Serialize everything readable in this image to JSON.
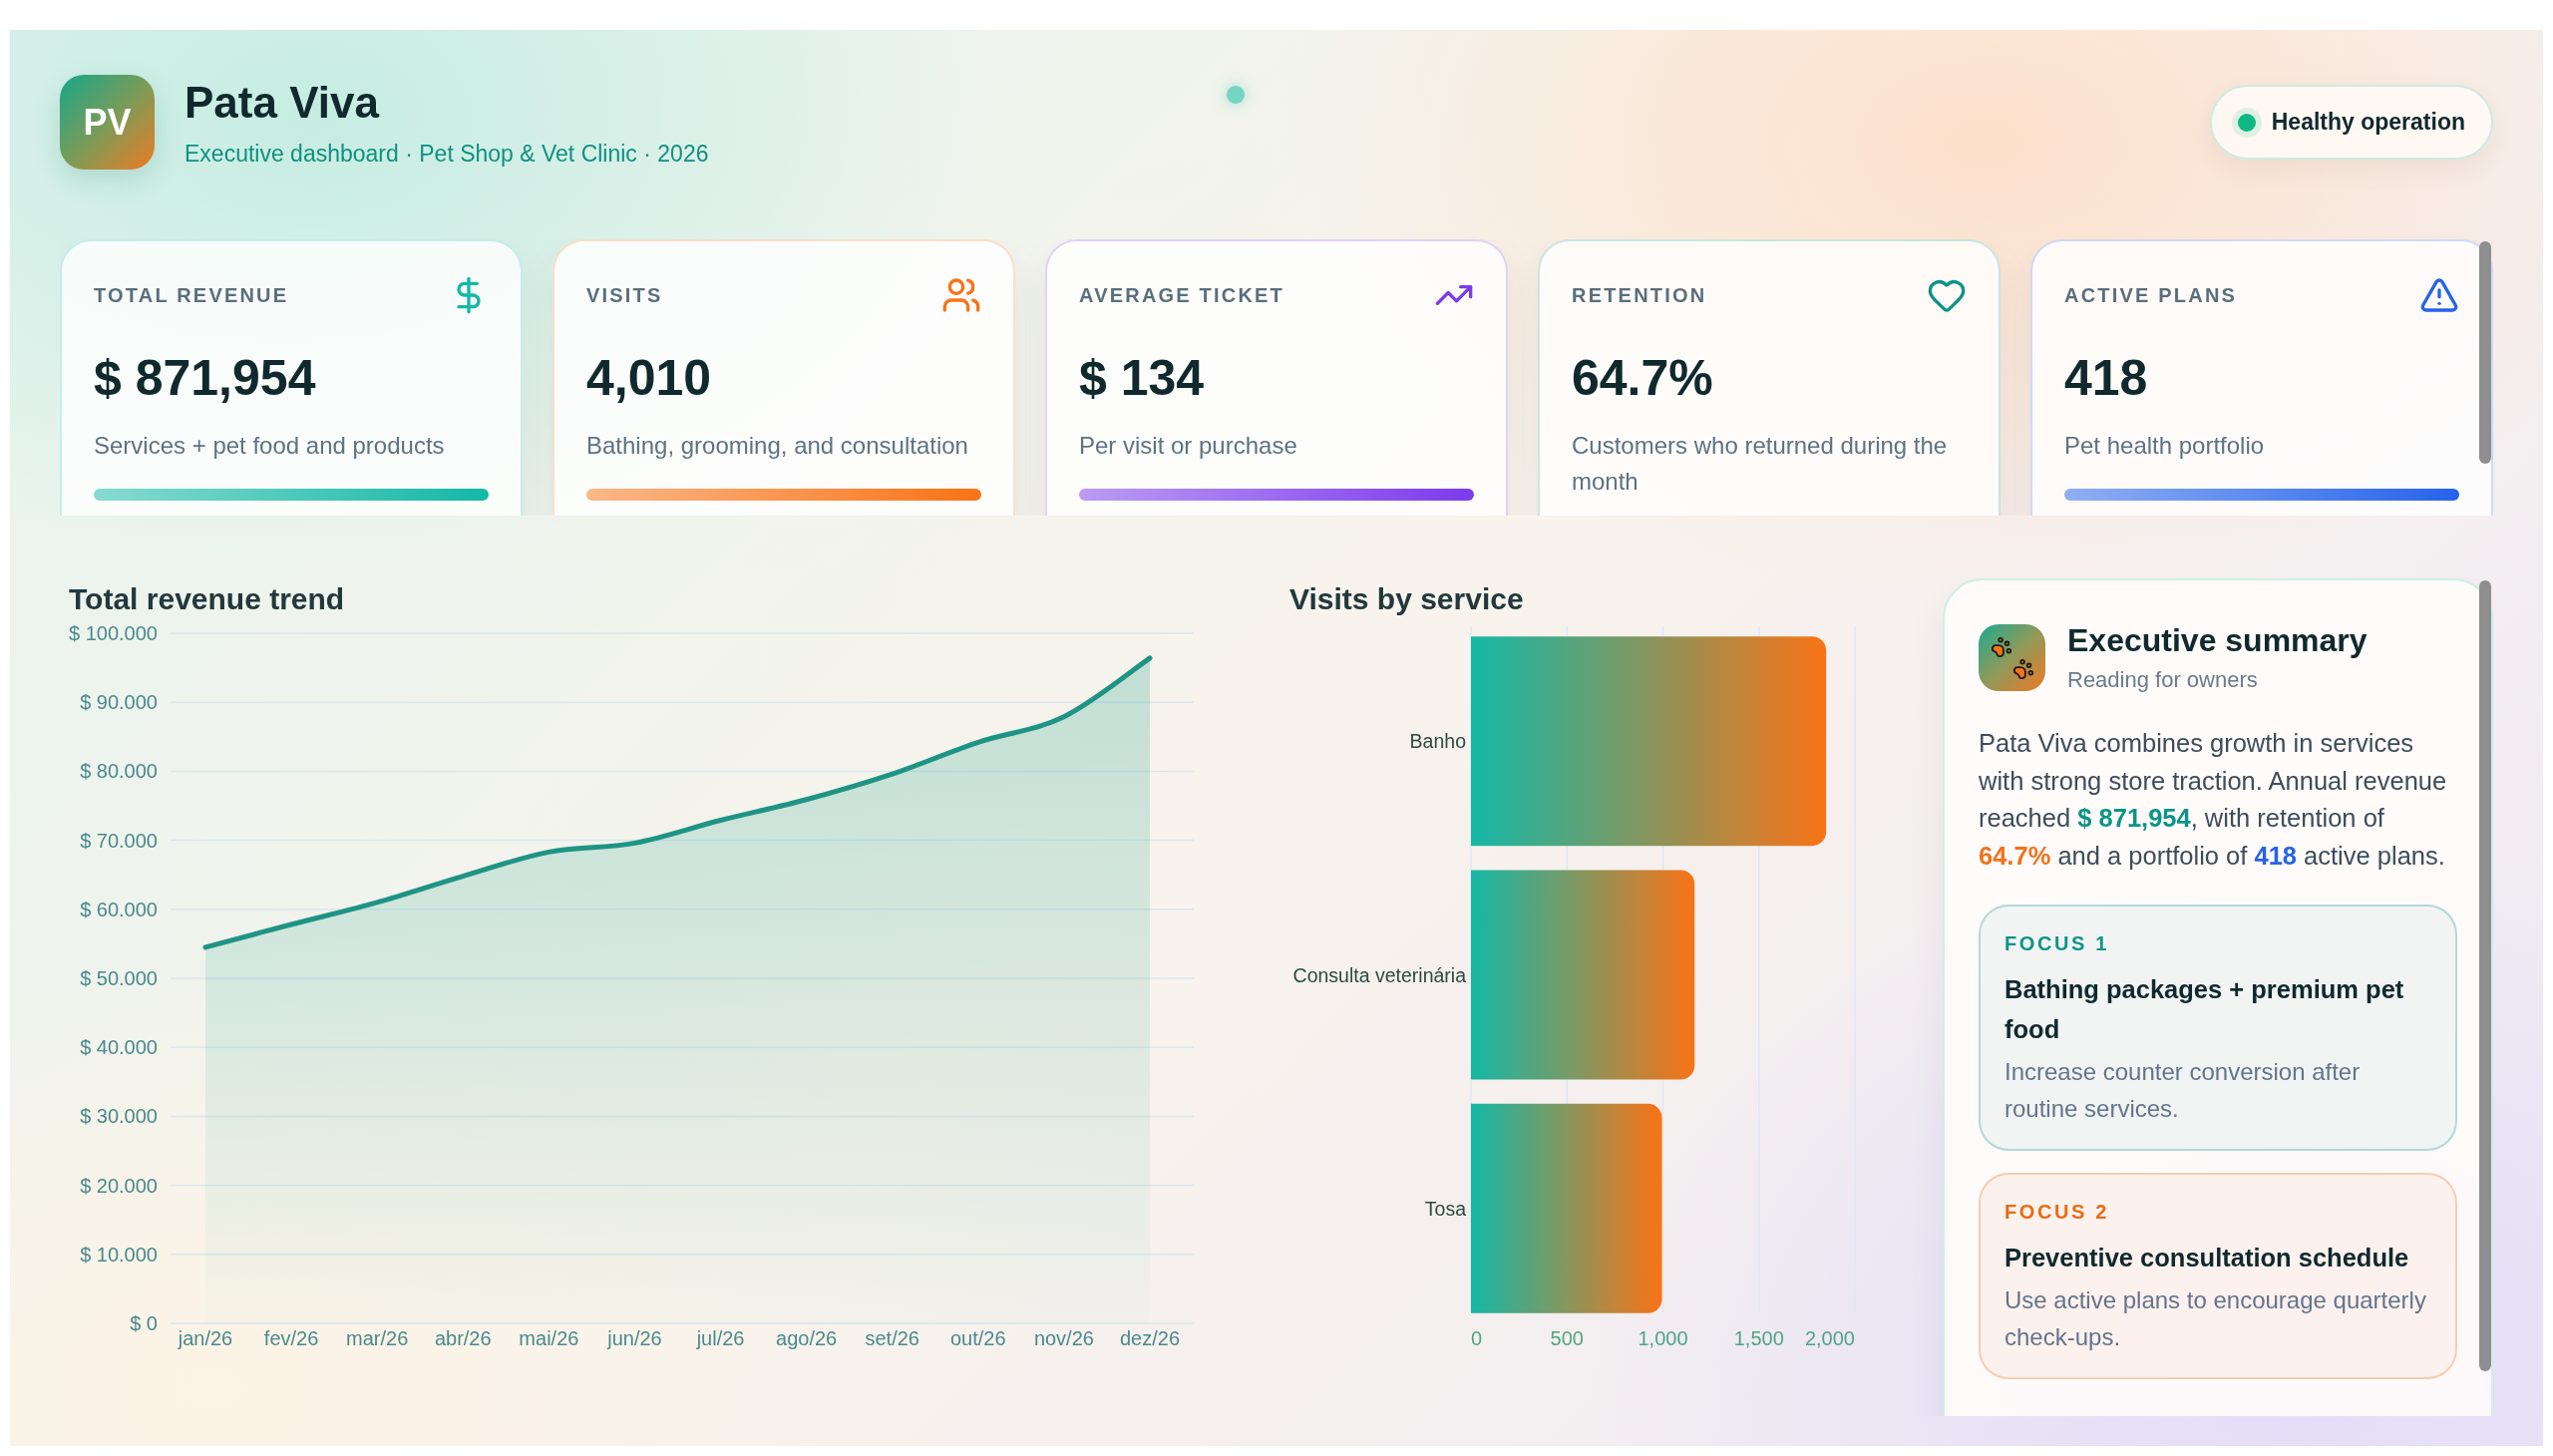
{
  "header": {
    "logo": "PV",
    "title": "Pata Viva",
    "subtitle": "Executive dashboard · Pet Shop & Vet Clinic · 2026",
    "status": {
      "label": "Healthy operation",
      "color": "#10b981"
    }
  },
  "kpis": [
    {
      "label": "TOTAL REVENUE",
      "value": "$ 871,954",
      "note": "Services + pet food and products",
      "color": "#14b8a6"
    },
    {
      "label": "VISITS",
      "value": "4,010",
      "note": "Bathing, grooming, and consultation",
      "color": "#f97316"
    },
    {
      "label": "AVERAGE TICKET",
      "value": "$ 134",
      "note": "Per visit or purchase",
      "color": "#7c3aed"
    },
    {
      "label": "RETENTION",
      "value": "64.7%",
      "note": "Customers who returned during the month",
      "color": "#0d9488"
    },
    {
      "label": "ACTIVE PLANS",
      "value": "418",
      "note": "Pet health portfolio",
      "color": "#2563eb"
    }
  ],
  "revenue_chart": {
    "chart_data": {
      "type": "area",
      "title": "Total revenue trend",
      "categories": [
        "jan/26",
        "fev/26",
        "mar/26",
        "abr/26",
        "mai/26",
        "jun/26",
        "jul/26",
        "ago/26",
        "set/26",
        "out/26",
        "nov/26",
        "dez/26"
      ],
      "series": [
        {
          "color": "#1f9484",
          "values": [
            54.5,
            57.8,
            61.0,
            64.8,
            68.3,
            69.6,
            72.9,
            75.9,
            79.6,
            84.2,
            87.9,
            96.4
          ]
        }
      ],
      "ylim": [
        0,
        100
      ],
      "yticks": [
        {
          "value": 0,
          "label": "$ 0"
        },
        {
          "value": 10,
          "label": "$ 10.000"
        },
        {
          "value": 20,
          "label": "$ 20.000"
        },
        {
          "value": 30,
          "label": "$ 30.000"
        },
        {
          "value": 40,
          "label": "$ 40.000"
        },
        {
          "value": 50,
          "label": "$ 50.000"
        },
        {
          "value": 60,
          "label": "$ 60.000"
        },
        {
          "value": 70,
          "label": "$ 70.000"
        },
        {
          "value": 80,
          "label": "$ 80.000"
        },
        {
          "value": 90,
          "label": "$ 90.000"
        },
        {
          "value": 100,
          "label": "$ 100.000"
        }
      ],
      "grid": true
    }
  },
  "visits_chart": {
    "chart_data": {
      "type": "bar",
      "orientation": "horizontal",
      "title": "Visits by service",
      "categories": [
        "Banho",
        "Consulta veterinária",
        "Tosa"
      ],
      "values": [
        1850,
        1165,
        995
      ],
      "xlim": [
        0,
        2000
      ],
      "xticks": [
        {
          "value": 0,
          "label": "0"
        },
        {
          "value": 500,
          "label": "500"
        },
        {
          "value": 1000,
          "label": "1,000"
        },
        {
          "value": 1500,
          "label": "1,500"
        },
        {
          "value": 2000,
          "label": "2,000"
        }
      ],
      "grid": true
    }
  },
  "summary": {
    "title": "Executive summary",
    "subtitle": "Reading for owners",
    "paragraph": [
      {
        "text": "Pata Viva combines growth in services with strong store traction. Annual revenue reached "
      },
      {
        "text": "$ 871,954",
        "color": "#0d9488"
      },
      {
        "text": ", with retention of "
      },
      {
        "text": "64.7%",
        "color": "#f2711c"
      },
      {
        "text": " and a portfolio of "
      },
      {
        "text": "418",
        "color": "#2563eb"
      },
      {
        "text": " active plans."
      }
    ],
    "focus": [
      {
        "label": "FOCUS 1",
        "title": "Bathing packages + premium pet food",
        "text": "Increase counter conversion after routine services.",
        "color": "#0d9488"
      },
      {
        "label": "FOCUS 2",
        "title": "Preventive consultation schedule",
        "text": "Use active plans to encourage quarterly check-ups.",
        "color": "#ea6a12"
      }
    ]
  }
}
